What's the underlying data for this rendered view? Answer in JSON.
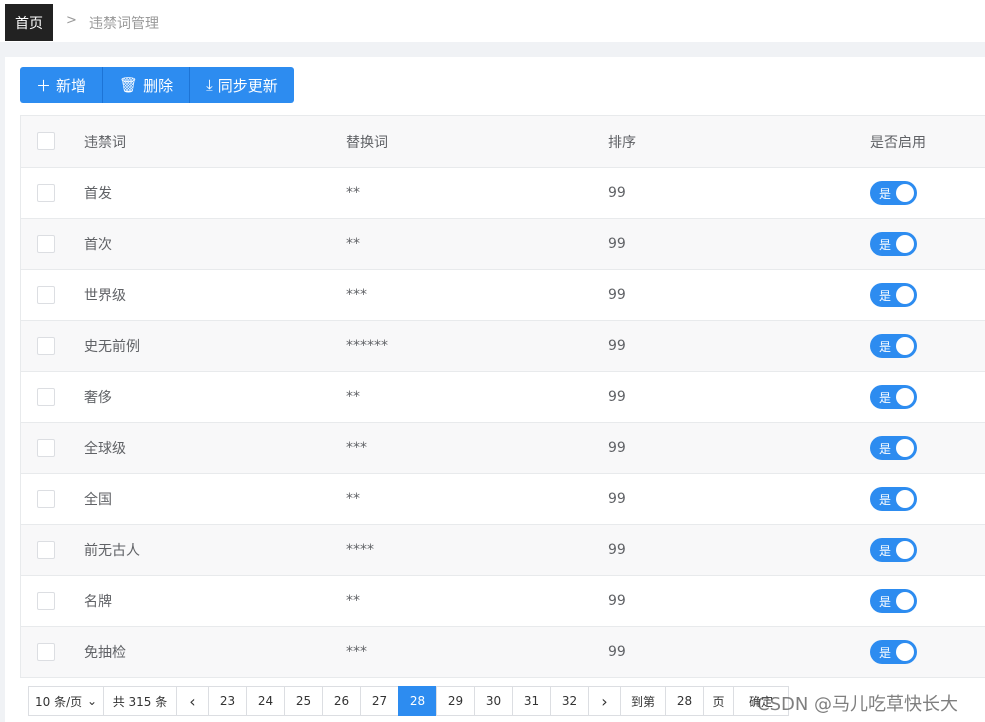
{
  "breadcrumb": {
    "home": "首页",
    "separator": ">",
    "current": "违禁词管理"
  },
  "toolbar": {
    "add": "新增",
    "delete": "删除",
    "sync": "同步更新"
  },
  "table": {
    "headers": [
      "违禁词",
      "替换词",
      "排序",
      "是否启用"
    ],
    "rows": [
      {
        "word": "首发",
        "replace": "**",
        "sort": "99",
        "enabled": "是"
      },
      {
        "word": "首次",
        "replace": "**",
        "sort": "99",
        "enabled": "是"
      },
      {
        "word": "世界级",
        "replace": "***",
        "sort": "99",
        "enabled": "是"
      },
      {
        "word": "史无前例",
        "replace": "******",
        "sort": "99",
        "enabled": "是"
      },
      {
        "word": "奢侈",
        "replace": "**",
        "sort": "99",
        "enabled": "是"
      },
      {
        "word": "全球级",
        "replace": "***",
        "sort": "99",
        "enabled": "是"
      },
      {
        "word": "全国",
        "replace": "**",
        "sort": "99",
        "enabled": "是"
      },
      {
        "word": "前无古人",
        "replace": "****",
        "sort": "99",
        "enabled": "是"
      },
      {
        "word": "名牌",
        "replace": "**",
        "sort": "99",
        "enabled": "是"
      },
      {
        "word": "免抽检",
        "replace": "***",
        "sort": "99",
        "enabled": "是"
      }
    ]
  },
  "pagination": {
    "page_size": "10 条/页",
    "total": "共 315 条",
    "pages": [
      "23",
      "24",
      "25",
      "26",
      "27",
      "28",
      "29",
      "30",
      "31",
      "32"
    ],
    "current": "28",
    "goto_label": "到第",
    "goto_value": "28",
    "page_label": "页",
    "confirm": "确定"
  },
  "watermark": "CSDN @马儿吃草快长大",
  "colors": {
    "primary": "#2d8cf0",
    "home_tab": "#222222"
  }
}
